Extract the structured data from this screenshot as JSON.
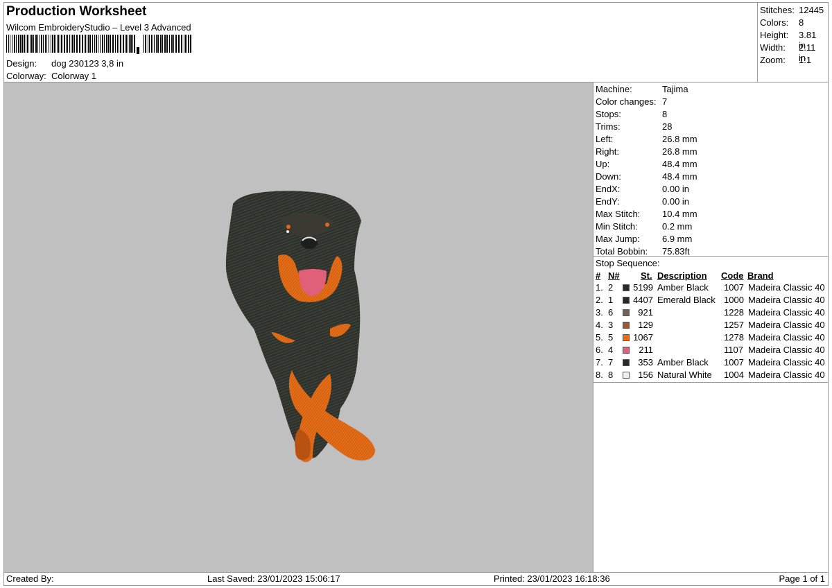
{
  "header": {
    "title": "Production Worksheet",
    "software": "Wilcom EmbroideryStudio – Level 3 Advanced",
    "design_label": "Design:",
    "design_value": "dog 230123 3,8 in",
    "colorway_label": "Colorway:",
    "colorway_value": "Colorway 1"
  },
  "summary": [
    {
      "label": "Stitches:",
      "value": "12445"
    },
    {
      "label": "Colors:",
      "value": "8"
    },
    {
      "label": "Height:",
      "value": "3.81 in"
    },
    {
      "label": "Width:",
      "value": "2.11 in"
    },
    {
      "label": "Zoom:",
      "value": "1:1"
    }
  ],
  "machine_info": [
    {
      "label": "Machine:",
      "value": "Tajima"
    },
    {
      "label": "Color changes:",
      "value": "7"
    },
    {
      "label": "Stops:",
      "value": "8"
    },
    {
      "label": "Trims:",
      "value": "28"
    },
    {
      "label": "Left:",
      "value": "26.8 mm"
    },
    {
      "label": "Right:",
      "value": "26.8 mm"
    },
    {
      "label": "Up:",
      "value": "48.4 mm"
    },
    {
      "label": "Down:",
      "value": "48.4 mm"
    },
    {
      "label": "EndX:",
      "value": "0.00 in"
    },
    {
      "label": "EndY:",
      "value": "0.00 in"
    },
    {
      "label": "Max Stitch:",
      "value": "10.4 mm"
    },
    {
      "label": "Min Stitch:",
      "value": "0.2 mm"
    },
    {
      "label": "Max Jump:",
      "value": "6.9 mm"
    },
    {
      "label": "Total Bobbin:",
      "value": "75.83ft"
    }
  ],
  "stop_sequence": {
    "title": "Stop Sequence:",
    "headers": {
      "num": "#",
      "n": "N#",
      "st": "St.",
      "desc": "Description",
      "code": "Code",
      "brand": "Brand"
    },
    "rows": [
      {
        "num": "1.",
        "n": "2",
        "color": "#2a2a2a",
        "st": "5199",
        "desc": "Amber Black",
        "code": "1007",
        "brand": "Madeira Classic 40"
      },
      {
        "num": "2.",
        "n": "1",
        "color": "#262b27",
        "st": "4407",
        "desc": "Emerald Black",
        "code": "1000",
        "brand": "Madeira Classic 40"
      },
      {
        "num": "3.",
        "n": "6",
        "color": "#736259",
        "st": "921",
        "desc": "",
        "code": "1228",
        "brand": "Madeira Classic 40"
      },
      {
        "num": "4.",
        "n": "3",
        "color": "#9b5a32",
        "st": "129",
        "desc": "",
        "code": "1257",
        "brand": "Madeira Classic 40"
      },
      {
        "num": "5.",
        "n": "5",
        "color": "#f06a10",
        "st": "1067",
        "desc": "",
        "code": "1278",
        "brand": "Madeira Classic 40"
      },
      {
        "num": "6.",
        "n": "4",
        "color": "#e0607a",
        "st": "211",
        "desc": "",
        "code": "1107",
        "brand": "Madeira Classic 40"
      },
      {
        "num": "7.",
        "n": "7",
        "color": "#2a2a2a",
        "st": "353",
        "desc": "Amber Black",
        "code": "1007",
        "brand": "Madeira Classic 40"
      },
      {
        "num": "8.",
        "n": "8",
        "color": "#ededf2",
        "st": "156",
        "desc": "Natural White",
        "code": "1004",
        "brand": "Madeira Classic 40"
      }
    ]
  },
  "footer": {
    "created_by": "Created By:",
    "last_saved": "Last Saved: 23/01/2023 15:06:17",
    "printed": "Printed: 23/01/2023 16:18:36",
    "page": "Page 1 of 1"
  },
  "colors": {
    "canvas_bg": "#c0c0c0",
    "dog_dark": "#2e322c",
    "dog_mid": "#4a4a3e",
    "tan": "#e0681a",
    "tongue": "#e0607a"
  }
}
